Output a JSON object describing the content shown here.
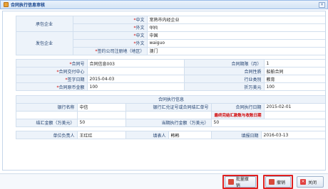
{
  "window": {
    "title": "合同执行信息审核",
    "close_label": "×"
  },
  "block1": {
    "contractor_group": "承包企业",
    "issuer_group": "发包企业",
    "zh_label": "中文",
    "en_label": "外文",
    "contractor_zh": "常熟市内经企业",
    "contractor_en": "qqq",
    "issuer_zh": "中国",
    "issuer_en": "waiguo",
    "sign_place_label": "签约公司注册地（地区）",
    "sign_place_value": "澳门"
  },
  "block2": {
    "contract_no_label": "合同号",
    "contract_no_value": "合同信息003",
    "period_label": "合同期限（月）",
    "period_value": "1",
    "center_label": "合同交付中心",
    "center_value": "",
    "nature_label": "合同性质",
    "nature_value": "船舶合同",
    "sign_date_label": "签字日期",
    "sign_date_value": "2015-04-03",
    "industry_label": "行业类别",
    "industry_value": "教育",
    "amount_label": "合同原币金额",
    "amount_value": "100",
    "usd_label": "折万美元",
    "usd_value": "100"
  },
  "block3": {
    "section_title": "合同执行信息",
    "bank_label": "银行名称",
    "bank_value": "中信",
    "slip_label": "银行汇兑证号或合同结汇单号",
    "slip_value": "",
    "exec_date_label": "合同执行日期",
    "exec_date_value": "2015-02-01",
    "warning": "最终完结汇款账与收账日期",
    "settle_label": "结汇金额（万美元）",
    "settle_value": "50",
    "current_label": "当期执行金额（万美元）",
    "current_value": "50"
  },
  "block4": {
    "unit_head_label": "单位负责人",
    "unit_head_value": "王红红",
    "filler_label": "填表人",
    "filler_value": "韩韩",
    "fill_date_label": "填报日期",
    "fill_date_value": "2016-03-13"
  },
  "buttons": {
    "batch_revoke": "批量撤销",
    "revoke": "撤销",
    "close": "关闭"
  },
  "colors": {
    "required": "#d00000",
    "highlight_box": "#e02020",
    "title_text": "#15428b"
  }
}
